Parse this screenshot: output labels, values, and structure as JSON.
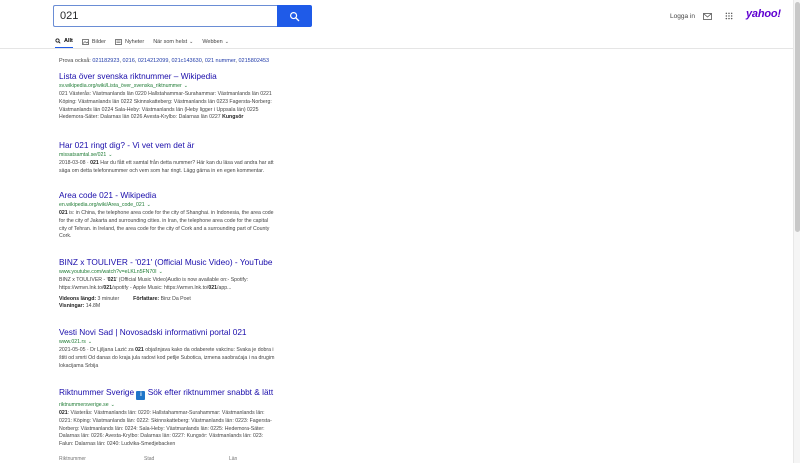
{
  "search": {
    "query": "021",
    "placeholder": ""
  },
  "header": {
    "login_label": "Logga in",
    "logo_text": "yahoo!",
    "logo_color": "#5f01d1",
    "search_button_color": "#1f5be8"
  },
  "tabs": [
    {
      "label": "Allt",
      "icon": "search-icon",
      "active": true
    },
    {
      "label": "Bilder",
      "icon": "image-icon",
      "active": false
    },
    {
      "label": "Nyheter",
      "icon": "news-icon",
      "active": false
    },
    {
      "label": "När som helst",
      "icon": "",
      "active": false,
      "dropdown": true
    },
    {
      "label": "Webben",
      "icon": "",
      "active": false,
      "dropdown": true
    }
  ],
  "also_try": {
    "label": "Prova också:",
    "links": [
      "021182923",
      "0216",
      "0214212099",
      "021c143630",
      "021 nummer",
      "0215802453"
    ]
  },
  "results": [
    {
      "title": "Lista över svenska riktnummer – Wikipedia",
      "url": "sv.wikipedia.org/wiki/Lista_över_svenska_riktnummer",
      "snippet": [
        "021 Västerås: Västmanlands län 0220 Hallstahammar-Surahammar: Västmanlands län 0221",
        "Köping: Västmanlands län 0222 Skinnskatteberg: Västmanlands län 0223 Fagersta-Norberg:",
        "Västmanlands län 0224 Sala-Heby: Västmanlands län (Heby ligger i Uppsala län) 0225",
        "Hedemora-Säter: Dalarnas län 0226 Avesta-Krylbo: Dalarnas län 0227 "
      ],
      "snippet_bold_tail": "Kungsör"
    },
    {
      "title": "Har 021 ringt dig? - Vi vet vem det är",
      "url": "missatsamtal.se/021",
      "date": "2018-03-08 · ",
      "bold_term": "021",
      "snippet": [
        " Har du fått ett samtal från detta nummer? Här kan du läsa vad andra har att",
        "säga om detta telefonnummer och vem som har ringt. Lägg gärna in en egen kommentar."
      ]
    },
    {
      "title": "Area code 021 - Wikipedia",
      "url": "en.wikipedia.org/wiki/Area_code_021",
      "bold_term": "021",
      "snippet": [
        " is: in China, the telephone area code for the city of Shanghai. in Indonesia, the area code",
        "for the city of Jakarta and surrounding cities. in Iran, the telephone area code for the capital",
        "city of Tehran. in Ireland, the area code for the city of Cork and a surrounding part of County",
        "Cork."
      ]
    },
    {
      "title": "BINZ x TOULIVER - '021' (Official Music Video) - YouTube",
      "url": "www.youtube.com/watch?v=eLKLn5FN70I",
      "snippet_line1_pre": "BINZ x TOULIVER - '",
      "snippet_line1_bold": "021",
      "snippet_line1_post": "' (Official Music Video)Audio is now available on:- Spotify:",
      "snippet_line2_pre": "https://wmvn.lnk.to/",
      "snippet_line2_bold": "021",
      "snippet_line2_mid": "/spotify - Apple Music: https://wmvn.lnk.to/",
      "snippet_line2_bold2": "021",
      "snippet_line2_post": "/app...",
      "meta": [
        {
          "label": "Videons längd:",
          "value": "3 minuter"
        },
        {
          "label": "Författare:",
          "value": "Binz Da Poet"
        },
        {
          "label": "Visningar:",
          "value": "14.8M"
        }
      ]
    },
    {
      "title": "Vesti Novi Sad | Novosadski informativni portal 021",
      "url": "www.021.rs",
      "date": "2021-05-05 · Dr Ljiljana Lazić za ",
      "bold_term": "021",
      "snippet": [
        " objašnjava kako da odaberete vakcinu: Svaka je dobra i",
        "štiti od smrti Od danas do kraja jula radovi kod petlje Subotica, izmena saobraćaja i na drugim",
        "lokacijama Srbija"
      ]
    },
    {
      "title": "Riktnummer Sverige ℹ️ Sök efter riktnummer snabbt & lätt",
      "title_pre": "Riktnummer Sverige ",
      "title_badge": "i",
      "title_post": " Sök efter riktnummer snabbt & lätt",
      "url": "riktnummersverige.se",
      "bold_term": "021",
      "snippet": [
        ": Västerås: Västmanlands län: 0220: Hallstahammar-Surahammar: Västmanlands län:",
        "0221: Köping: Västmanlands län: 0222: Skinnskatteberg: Västmanlands län: 0223: Fagersta-",
        "Norberg: Västmanlands län: 0224: Sala-Heby: Västmanlands län: 0225: Hedemora-Säter:",
        "Dalarnas län: 0226: Avesta-Krylbo: Dalarnas län: 0227: Kungsör: Västmanlands län: 023:",
        "Falun: Dalarnas län: 0240: Ludvika-Smedjebacken"
      ]
    }
  ],
  "table_headers": [
    "Riktnummer",
    "Stad",
    "Län"
  ]
}
